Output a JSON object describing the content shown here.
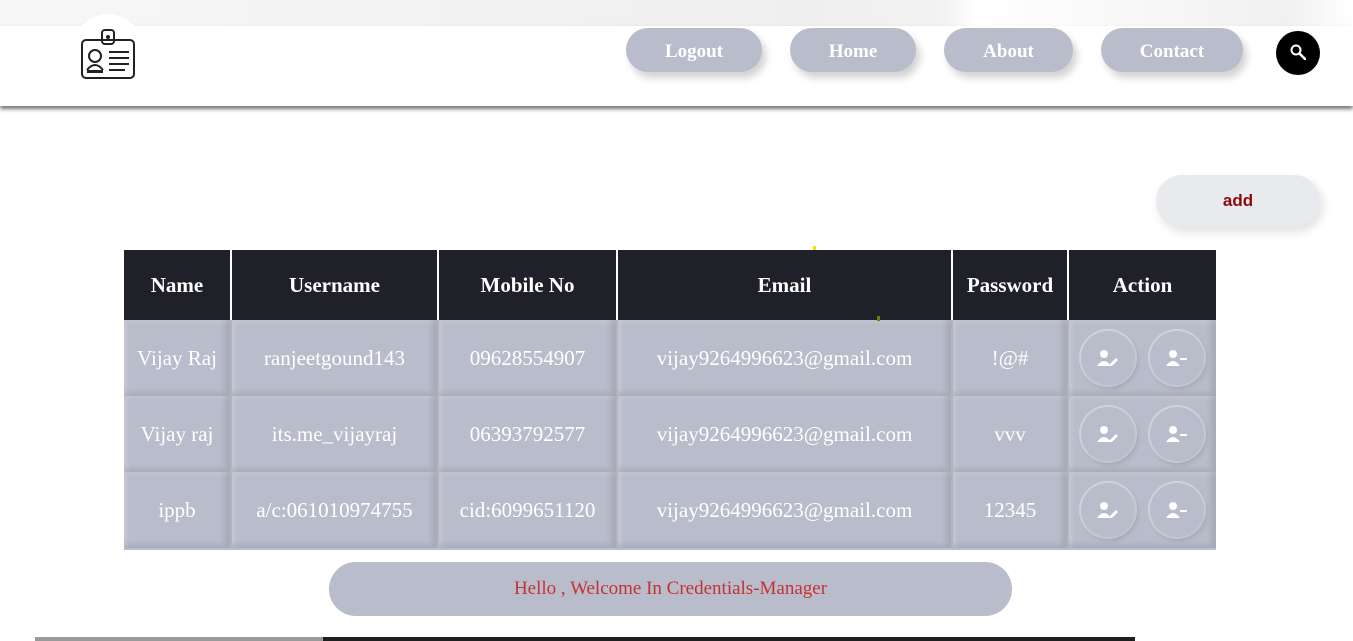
{
  "nav": {
    "logout": "Logout",
    "home": "Home",
    "about": "About",
    "contact": "Contact"
  },
  "icons": {
    "logo": "id-badge-icon",
    "search": "search-icon",
    "edit": "user-edit-icon",
    "delete": "user-minus-icon"
  },
  "add_label": "add",
  "table": {
    "headers": [
      "Name",
      "Username",
      "Mobile No",
      "Email",
      "Password",
      "Action"
    ],
    "rows": [
      [
        "Vijay Raj",
        "ranjeetgound143",
        "09628554907",
        "vijay9264996623@gmail.com",
        "!@#"
      ],
      [
        "Vijay raj",
        "its.me_vijayraj",
        "06393792577",
        "vijay9264996623@gmail.com",
        "vvv"
      ],
      [
        "ippb",
        "a/c:061010974755",
        "cid:6099651120",
        "vijay9264996623@gmail.com",
        "12345"
      ]
    ]
  },
  "welcome": "Hello , Welcome In Credentials-Manager",
  "colors": {
    "nav_bg": "#b9bccb",
    "table_header": "#1f2028",
    "add_text": "#8b0b0b",
    "welcome_text": "#c63232"
  }
}
